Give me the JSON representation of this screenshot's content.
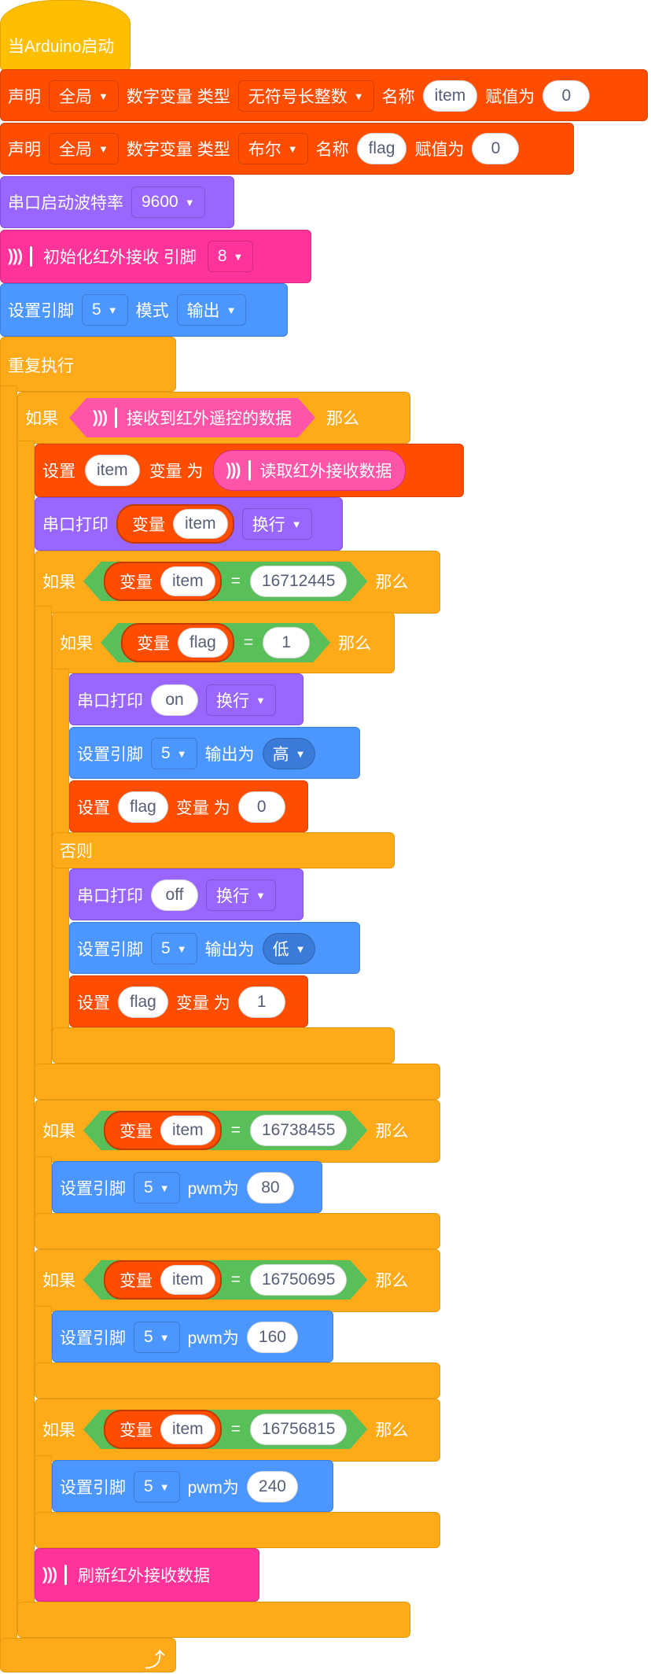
{
  "hat": {
    "label": "当Arduino启动"
  },
  "declare1": {
    "declare": "声明",
    "scope": "全局",
    "numvar": "数字变量 类型",
    "type": "无符号长整数",
    "name_label": "名称",
    "name": "item",
    "assign": "赋值为",
    "value": "0"
  },
  "declare2": {
    "declare": "声明",
    "scope": "全局",
    "numvar": "数字变量 类型",
    "type": "布尔",
    "name_label": "名称",
    "name": "flag",
    "assign": "赋值为",
    "value": "0"
  },
  "serial_begin": {
    "label": "串口启动波特率",
    "baud": "9600"
  },
  "ir_init": {
    "label": "初始化红外接收 引脚",
    "pin": "8"
  },
  "pin_mode": {
    "label": "设置引脚",
    "pin": "5",
    "mode_label": "模式",
    "mode": "输出"
  },
  "repeat": {
    "label": "重复执行"
  },
  "if_ir": {
    "if": "如果",
    "cond": "接收到红外遥控的数据",
    "then": "那么"
  },
  "set_item": {
    "set": "设置",
    "var": "item",
    "as": "变量 为",
    "reporter": "读取红外接收数据"
  },
  "print_item": {
    "label": "串口打印",
    "var_label": "变量",
    "var": "item",
    "newline": "换行"
  },
  "if_code1": {
    "if": "如果",
    "var_label": "变量",
    "var": "item",
    "eq": "=",
    "value": "16712445",
    "then": "那么"
  },
  "if_flag": {
    "if": "如果",
    "var_label": "变量",
    "var": "flag",
    "eq": "=",
    "value": "1",
    "then": "那么"
  },
  "print_on": {
    "label": "串口打印",
    "text": "on",
    "newline": "换行"
  },
  "write_high": {
    "label": "设置引脚",
    "pin": "5",
    "out": "输出为",
    "level": "高"
  },
  "set_flag0": {
    "set": "设置",
    "var": "flag",
    "as": "变量 为",
    "value": "0"
  },
  "else": {
    "label": "否则"
  },
  "print_off": {
    "label": "串口打印",
    "text": "off",
    "newline": "换行"
  },
  "write_low": {
    "label": "设置引脚",
    "pin": "5",
    "out": "输出为",
    "level": "低"
  },
  "set_flag1": {
    "set": "设置",
    "var": "flag",
    "as": "变量 为",
    "value": "1"
  },
  "if_code2": {
    "if": "如果",
    "var_label": "变量",
    "var": "item",
    "eq": "=",
    "value": "16738455",
    "then": "那么"
  },
  "pwm1": {
    "label": "设置引脚",
    "pin": "5",
    "pwm": "pwm为",
    "value": "80"
  },
  "if_code3": {
    "if": "如果",
    "var_label": "变量",
    "var": "item",
    "eq": "=",
    "value": "16750695",
    "then": "那么"
  },
  "pwm2": {
    "label": "设置引脚",
    "pin": "5",
    "pwm": "pwm为",
    "value": "160"
  },
  "if_code4": {
    "if": "如果",
    "var_label": "变量",
    "var": "item",
    "eq": "=",
    "value": "16756815",
    "then": "那么"
  },
  "pwm3": {
    "label": "设置引脚",
    "pin": "5",
    "pwm": "pwm为",
    "value": "240"
  },
  "ir_refresh": {
    "label": "刷新红外接收数据"
  },
  "colors": {
    "events": "#ffbf00",
    "variables": "#ff4d00",
    "serial": "#9966ff",
    "infrared": "#ff3399",
    "pins": "#4c97ff",
    "control": "#ffab19",
    "operators": "#59c059"
  },
  "icons": {
    "ir": "infrared-signal-icon",
    "caret": "chevron-down-icon",
    "loop": "loop-arrow-icon"
  }
}
